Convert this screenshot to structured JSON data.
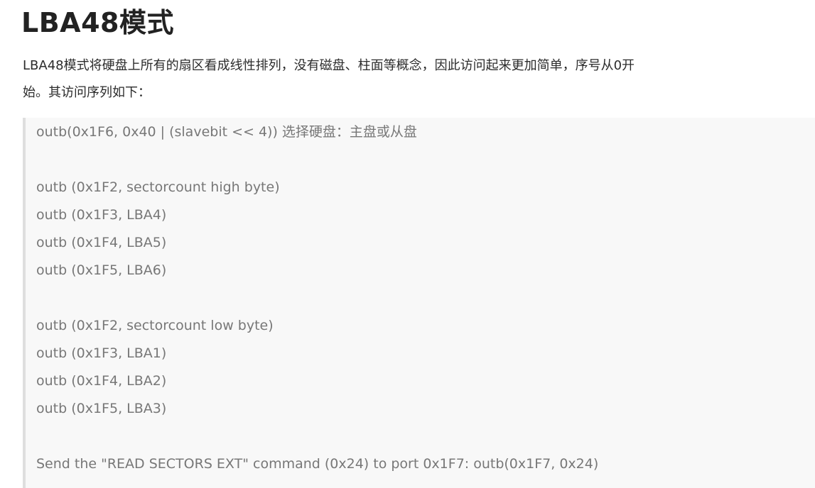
{
  "heading": "LBA48模式",
  "paragraph": {
    "line1": "LBA48模式将硬盘上所有的扇区看成线性排列，没有磁盘、柱面等概念，因此访问起来更加简单，序号从0开",
    "line2": "始。其访问序列如下："
  },
  "quote": {
    "select": "outb(0x1F6, 0x40 | (slavebit << 4)) 选择硬盘：主盘或从盘",
    "high_group": [
      "outb (0x1F2, sectorcount high byte)",
      "outb (0x1F3, LBA4)",
      "outb (0x1F4, LBA5)",
      "outb (0x1F5, LBA6)"
    ],
    "low_group": [
      "outb (0x1F2, sectorcount low byte)",
      "outb (0x1F3, LBA1)",
      "outb (0x1F4, LBA2)",
      "outb (0x1F5, LBA3)"
    ],
    "command": "Send the \"READ SECTORS EXT\" command (0x24) to port 0x1F7: outb(0x1F7, 0x24)"
  }
}
